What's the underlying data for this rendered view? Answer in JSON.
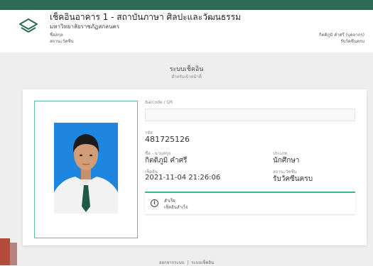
{
  "header": {
    "title": "เช็คอินอาคาร 1 - สถาบันภาษา ศิลปะและวัฒนธรรม",
    "subtitle": "มหาวิทยาลัยราชภัฏสกลนคร",
    "left_line1": "ชื่อสกุล",
    "left_line2": "สถานะวัคซีน",
    "right_line1": "กิตติภูมิ คำศรี (บุคลากร)",
    "right_line2": "รับวัคซีนครบ",
    "logo_icon": "layers-icon",
    "accent_color": "#2e6b55"
  },
  "system": {
    "title": "ระบบเช็คอิน",
    "subtitle": "สำหรับเจ้าหน้าที่"
  },
  "form": {
    "barcode_label": "Barcode / QR",
    "barcode_value": "",
    "code_label": "รหัส",
    "code_value": "481725126",
    "name_label": "ชื่อ - นามสกุล",
    "name_value": "กิตติภูมิ คำศรี",
    "type_label": "ประเภท",
    "type_value": "นักศึกษา",
    "checkin_label": "เช็คอิน",
    "checkin_value": "2021-11-04 21:26:06",
    "vaccine_label": "สถานะวัคซีน",
    "vaccine_value": "รับวัคซีนครบ"
  },
  "status": {
    "icon": "info-icon",
    "title": "สำเร็จ",
    "message": "เช็คอินสำเร็จ",
    "color": "#3fb58a"
  },
  "footer": {
    "logout": "ออกจากระบบ",
    "separator": "|",
    "checkin_system": "ระบบเช็คอิน"
  }
}
